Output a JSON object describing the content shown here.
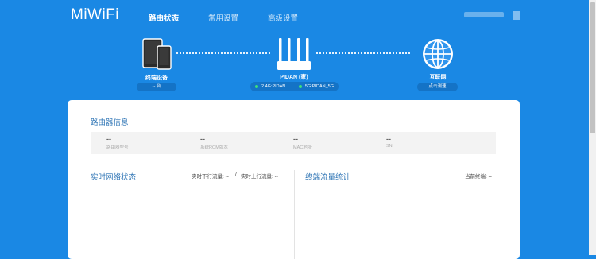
{
  "brand": {
    "logo": "MiWiFi"
  },
  "nav": {
    "tabs": [
      "路由状态",
      "常用设置",
      "高级设置"
    ],
    "active": 0
  },
  "topology": {
    "terminal": {
      "label": "终端设备",
      "count": "-- 台"
    },
    "router": {
      "label": "PIDAN (家)",
      "wifi_24": "2.4G:PIDAN",
      "wifi_5": "5G:PIDAN_5G"
    },
    "internet": {
      "label": "互联网",
      "action": "点击测速"
    }
  },
  "router_info": {
    "title": "路由器信息",
    "items": [
      {
        "value": "--",
        "caption": "路由器型号"
      },
      {
        "value": "--",
        "caption": "系统ROM版本"
      },
      {
        "value": "--",
        "caption": "MAC地址"
      },
      {
        "value": "--",
        "caption": "SN"
      }
    ]
  },
  "realtime": {
    "title": "实时网络状态",
    "download": "实时下行流量: --",
    "separator": "/",
    "upload": "实时上行流量: --"
  },
  "traffic": {
    "title": "终端流量统计",
    "current": "当前终端: --"
  },
  "colors": {
    "background": "#1a88e4",
    "accent": "#2d74b5",
    "wifi_on": "#3de07a"
  }
}
